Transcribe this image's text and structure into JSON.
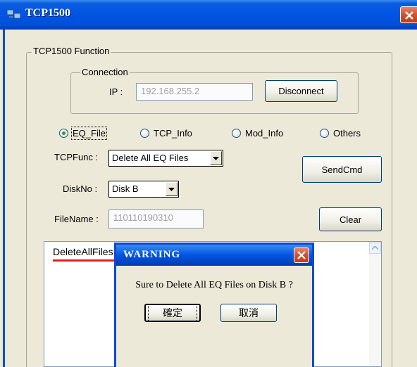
{
  "window": {
    "title": "TCP1500"
  },
  "function_group": {
    "legend": "TCP1500 Function"
  },
  "connection": {
    "legend": "Connection",
    "ip_label": "IP :",
    "ip_value": "192.168.255.2",
    "disconnect_label": "Disconnect"
  },
  "radios": [
    {
      "label": "EQ_File",
      "checked": true
    },
    {
      "label": "TCP_Info",
      "checked": false
    },
    {
      "label": "Mod_Info",
      "checked": false
    },
    {
      "label": "Others",
      "checked": false
    }
  ],
  "tcpfunc": {
    "label": "TCPFunc :",
    "selected": "Delete All EQ Files"
  },
  "diskno": {
    "label": "DiskNo :",
    "selected": "Disk B"
  },
  "filename": {
    "label": "FileName :",
    "value": "110110190310"
  },
  "buttons": {
    "sendcmd": "SendCmd",
    "clear": "Clear"
  },
  "log": {
    "lines": [
      "DeleteAllFiles on \"Disk B:\" OK"
    ]
  },
  "dialog": {
    "title": "WARNING",
    "message": "Sure to Delete All EQ Files on Disk B ?",
    "ok_label": "確定",
    "cancel_label": "取消"
  },
  "colors": {
    "titlebar": "#0054e3",
    "close": "#d64f2e",
    "annotation_underline": "#e02020"
  }
}
